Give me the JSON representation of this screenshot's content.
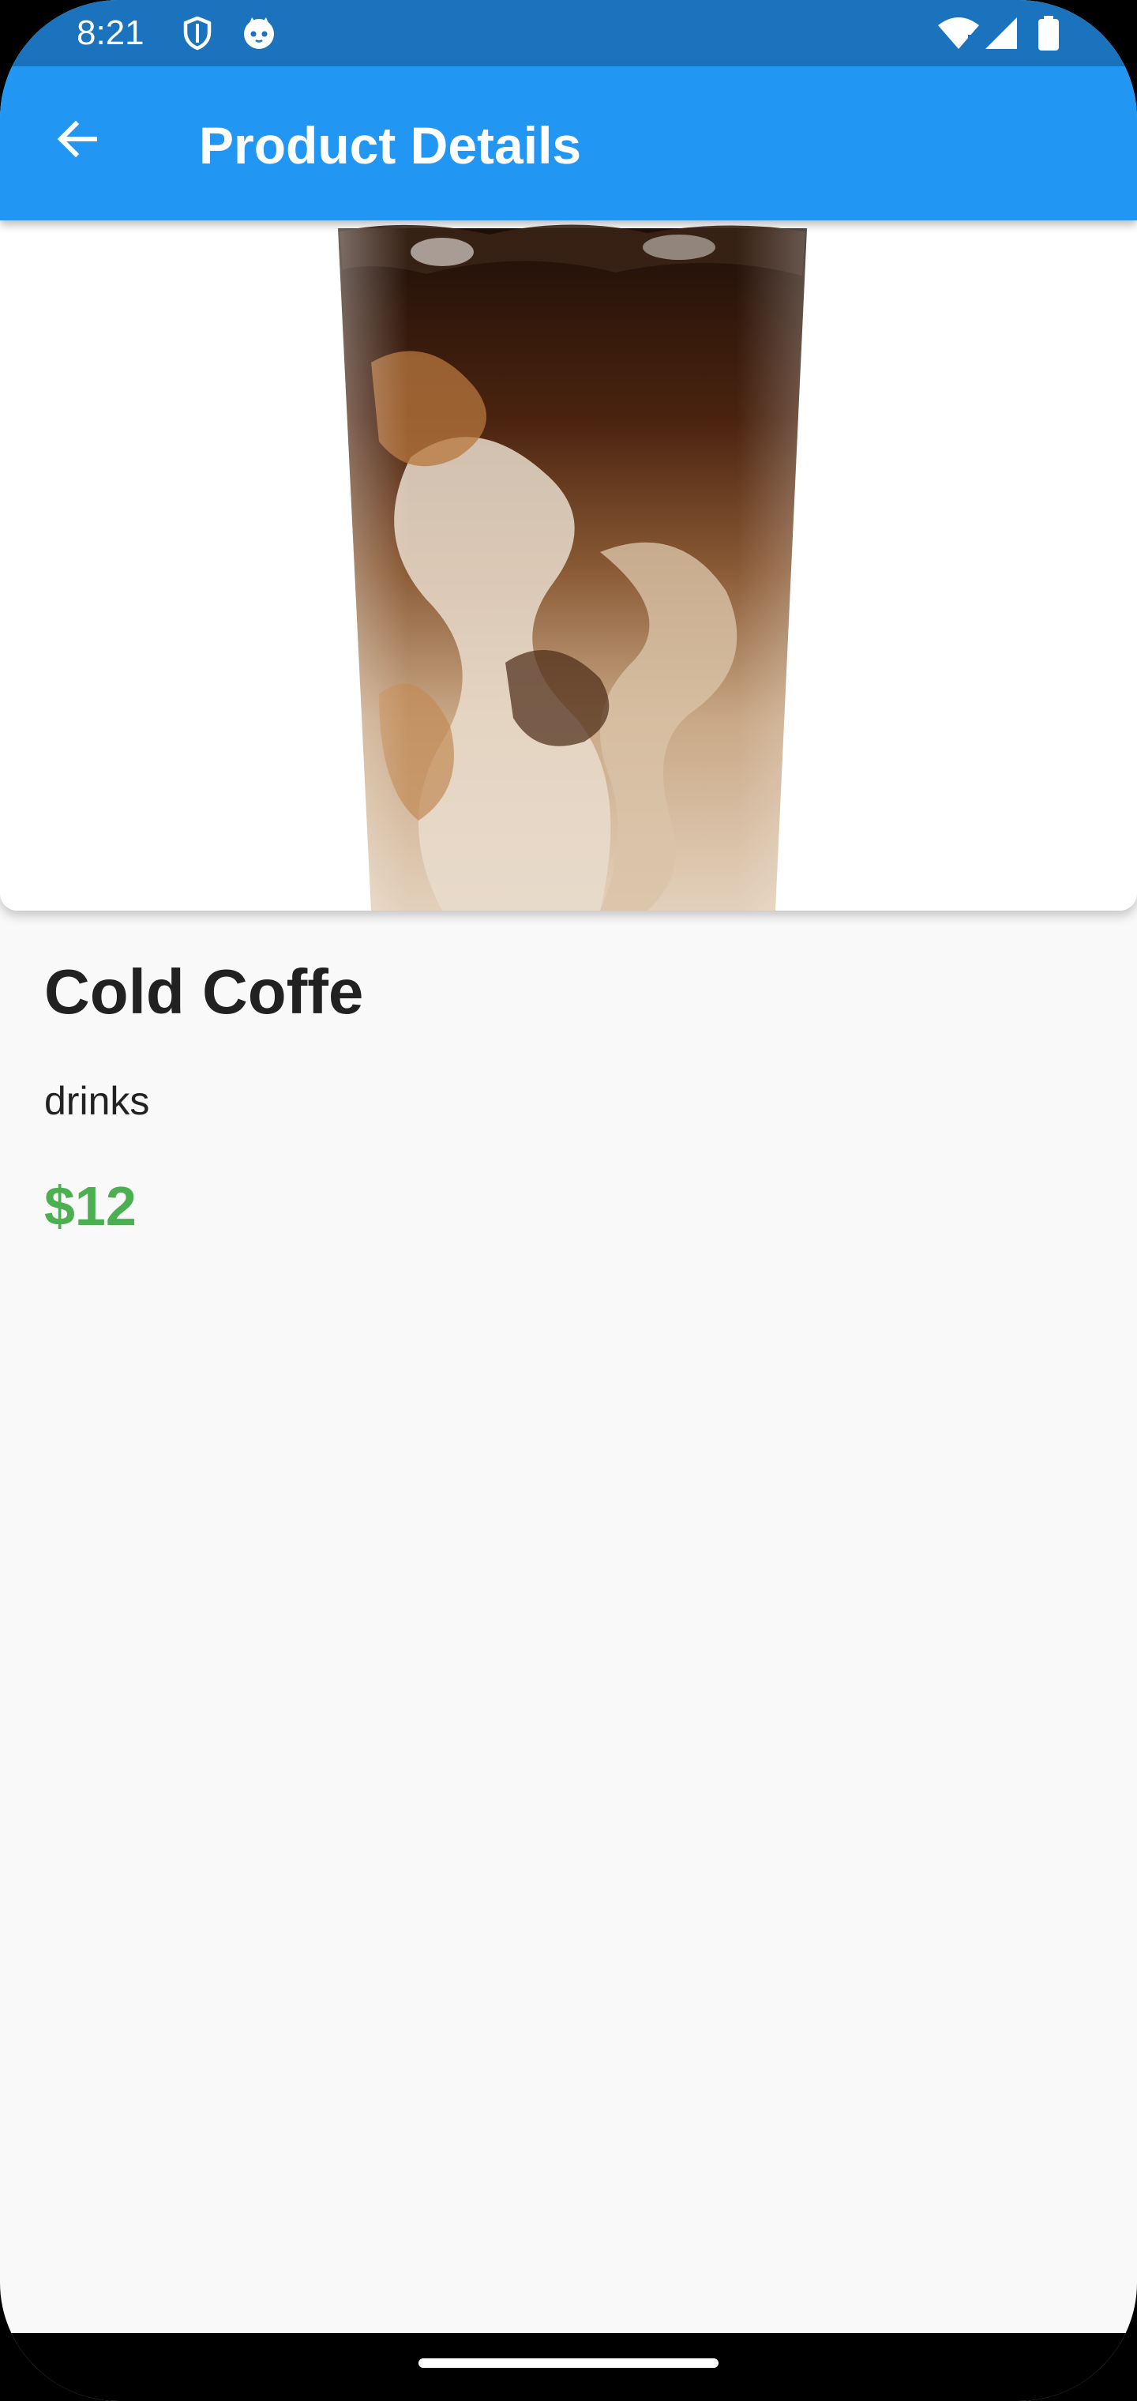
{
  "status_bar": {
    "time": "8:21",
    "icons": [
      "shield-icon",
      "cat-face-icon",
      "wifi-icon",
      "cellular-signal-icon",
      "battery-icon"
    ]
  },
  "app_bar": {
    "title": "Product Details",
    "back_icon": "arrow-left-icon"
  },
  "product": {
    "image": "iced-coffee-glass",
    "name": "Cold Coffe",
    "category": "drinks",
    "price": "$12"
  },
  "colors": {
    "status_bar": "#1b72bd",
    "app_bar": "#2196f3",
    "background": "#f9f9f9",
    "price": "#4caf50",
    "name": "#212121"
  }
}
